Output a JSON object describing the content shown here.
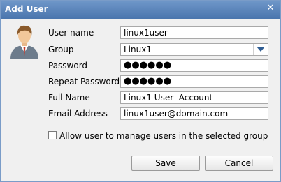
{
  "window": {
    "title": "Add User",
    "close_glyph": "✕"
  },
  "form": {
    "user_name": {
      "label": "User name",
      "value": "linux1user"
    },
    "group": {
      "label": "Group",
      "value": "Linux1"
    },
    "password": {
      "label": "Password",
      "value": "●●●●●●"
    },
    "repeat_password": {
      "label": "Repeat Password",
      "value": "●●●●●●"
    },
    "full_name": {
      "label": "Full Name",
      "value": "Linux1 User  Account"
    },
    "email": {
      "label": "Email Address",
      "value": "linux1user@domain.com"
    },
    "allow_manage": {
      "label": "Allow user to manage users in the selected group",
      "checked": false
    }
  },
  "buttons": {
    "save": "Save",
    "cancel": "Cancel"
  },
  "icons": {
    "avatar": "user-avatar-icon",
    "dropdown": "chevron-down-icon",
    "close": "close-icon"
  },
  "colors": {
    "titlebar": "#4f7ab1",
    "dropdown_arrow": "#2f5d93"
  }
}
